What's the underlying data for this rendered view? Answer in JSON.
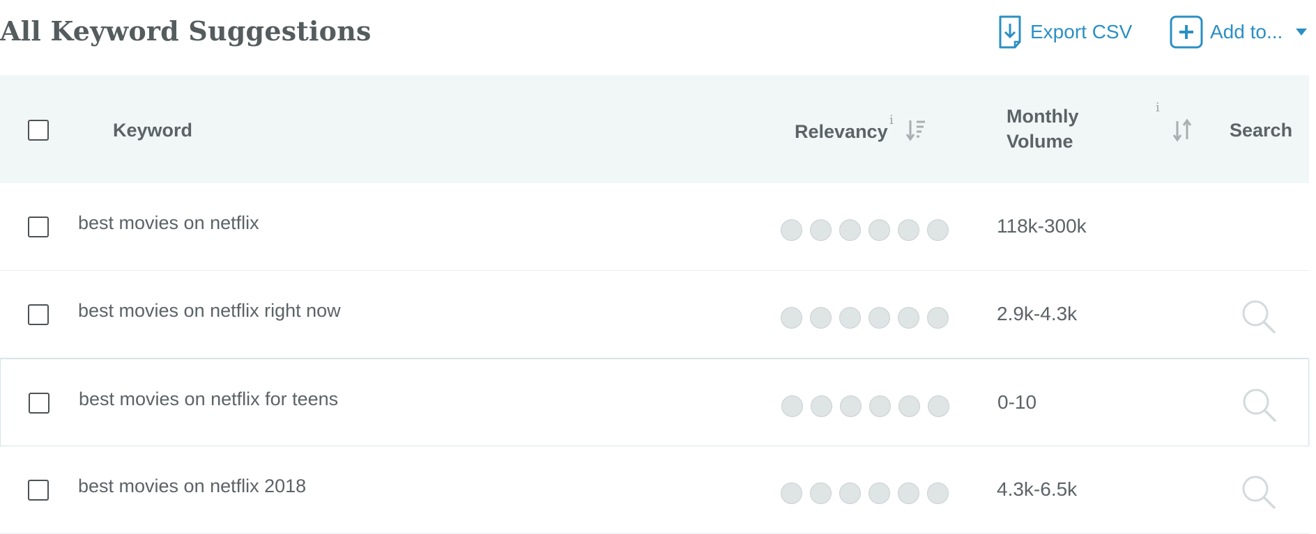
{
  "header": {
    "title": "All Keyword Suggestions",
    "export_label": "Export CSV",
    "add_label": "Add to..."
  },
  "table": {
    "columns": {
      "keyword": "Keyword",
      "relevancy": "Relevancy",
      "volume_line1": "Monthly",
      "volume_line2": "Volume",
      "search": "Search"
    },
    "info_glyph": "i",
    "rows": [
      {
        "keyword": "best movies on netflix",
        "volume": "118k-300k",
        "relevancy_dots": 6,
        "search_icon": "none"
      },
      {
        "keyword": "best movies on netflix right now",
        "volume": "2.9k-4.3k",
        "relevancy_dots": 6,
        "search_icon": "magnifier-icon"
      },
      {
        "keyword": "best movies on netflix for teens",
        "volume": "0-10",
        "relevancy_dots": 6,
        "search_icon": "magnifier-icon"
      },
      {
        "keyword": "best movies on netflix 2018",
        "volume": "4.3k-6.5k",
        "relevancy_dots": 6,
        "search_icon": "magnifier-icon"
      }
    ]
  },
  "colors": {
    "accent": "#2b8fc4",
    "header_bg": "#f1f6f6",
    "text": "#5c6366",
    "dot_fill": "#dfe4e4"
  }
}
